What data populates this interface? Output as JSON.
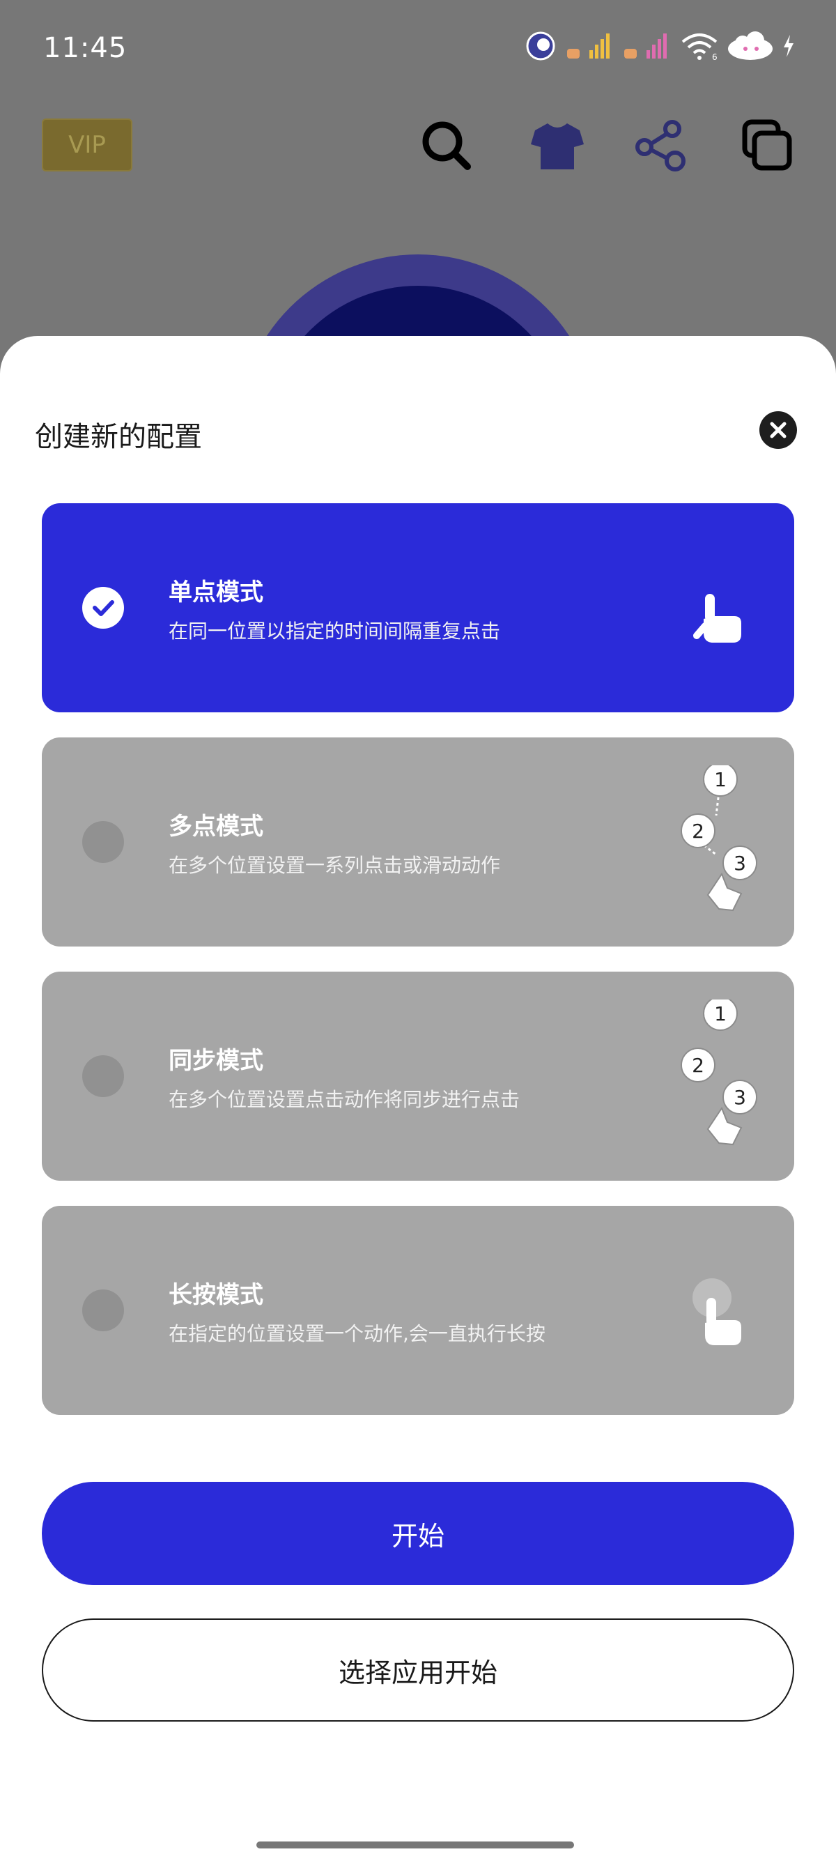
{
  "status_bar": {
    "time": "11:45",
    "icons": [
      "notification-badge-icon",
      "signal-icon",
      "signal-icon",
      "wifi-icon",
      "cloud-icon",
      "charging-icon"
    ],
    "wifi_sub": "6"
  },
  "top_bar": {
    "vip_label": "VIP",
    "icons": [
      "search-icon",
      "tshirt-icon",
      "share-icon",
      "copy-icon"
    ]
  },
  "sheet": {
    "title": "创建新的配置",
    "close_icon": "close-icon",
    "modes": [
      {
        "title": "单点模式",
        "description": "在同一位置以指定的时间间隔重复点击",
        "selected": true,
        "icon": "single-tap-icon"
      },
      {
        "title": "多点模式",
        "description": "在多个位置设置一系列点击或滑动动作",
        "selected": false,
        "icon": "multi-tap-icon",
        "markers": [
          "1",
          "2",
          "3"
        ]
      },
      {
        "title": "同步模式",
        "description": "在多个位置设置点击动作将同步进行点击",
        "selected": false,
        "icon": "sync-tap-icon",
        "markers": [
          "1",
          "2",
          "3"
        ]
      },
      {
        "title": "长按模式",
        "description": "在指定的位置设置一个动作,会一直执行长按",
        "selected": false,
        "icon": "long-press-icon"
      }
    ],
    "start_label": "开始",
    "select_app_label": "选择应用开始"
  },
  "colors": {
    "accent": "#2b2bd9",
    "card_inactive": "#a6a6a6",
    "overlay_bg": "#777777"
  }
}
